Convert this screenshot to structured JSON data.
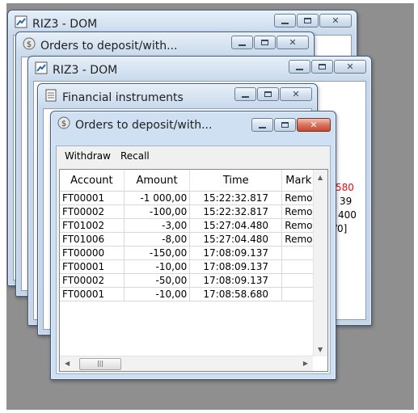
{
  "windows": {
    "w1_title": "RIZ3 - DOM",
    "w2_title": "Orders to deposit/with...",
    "w3_title": "RIZ3 - DOM",
    "w4_title": "Financial instruments",
    "front_title": "Orders to deposit/with..."
  },
  "menu": {
    "withdraw": "Withdraw",
    "recall": "Recall"
  },
  "columns": {
    "account": "Account",
    "amount": "Amount",
    "time": "Time",
    "mark": "Mark"
  },
  "rows": [
    {
      "account": "FT00001",
      "amount": "-1 000,00",
      "time": "15:22:32.817",
      "mark": "Remove"
    },
    {
      "account": "FT00002",
      "amount": "-100,00",
      "time": "15:22:32.817",
      "mark": "Remove"
    },
    {
      "account": "FT01002",
      "amount": "-3,00",
      "time": "15:27:04.480",
      "mark": "Remove"
    },
    {
      "account": "FT01006",
      "amount": "-8,00",
      "time": "15:27:04.480",
      "mark": "Remove"
    },
    {
      "account": "FT00000",
      "amount": "-150,00",
      "time": "17:08:09.137",
      "mark": ""
    },
    {
      "account": "FT00001",
      "amount": "-10,00",
      "time": "17:08:09.137",
      "mark": ""
    },
    {
      "account": "FT00002",
      "amount": "-50,00",
      "time": "17:08:09.137",
      "mark": ""
    },
    {
      "account": "FT00001",
      "amount": "-10,00",
      "time": "17:08:58.680",
      "mark": ""
    }
  ],
  "behind_text": {
    "line1": "580",
    "line2": "39",
    "line3": "400",
    "line4": "/0]"
  },
  "icons": {
    "dom": "chart-arrow-icon",
    "orders": "dollar-coin-icon",
    "instruments": "document-list-icon"
  },
  "colors": {
    "close_button": "#c44a2e",
    "negative_value": "#e01010"
  }
}
